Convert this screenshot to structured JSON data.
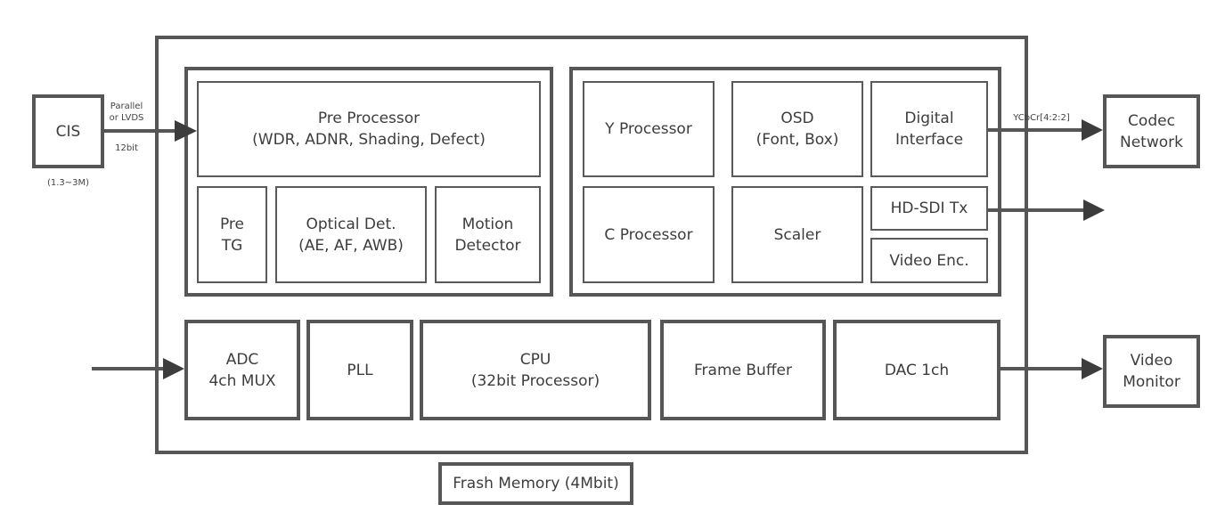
{
  "external": {
    "cis": {
      "label": "CIS",
      "caption": "(1.3~3M)"
    },
    "codec": {
      "label": "Codec\nNetwork"
    },
    "video_monitor": {
      "label": "Video\nMonitor"
    },
    "flash_memory": {
      "label": "Frash Memory (4Mbit)"
    }
  },
  "connections": {
    "cis_to_pre": {
      "label_top": "Parallel\nor LVDS",
      "label_bottom": "12bit"
    },
    "digital_to_codec": {
      "label": "YCbCr[4:2:2]"
    }
  },
  "pre_group": {
    "pre_processor": {
      "label": "Pre Processor\n(WDR, ADNR, Shading, Defect)"
    },
    "pre_tg": {
      "label": "Pre\nTG"
    },
    "optical_det": {
      "label": "Optical Det.\n(AE, AF, AWB)"
    },
    "motion_detector": {
      "label": "Motion\nDetector"
    }
  },
  "post_group": {
    "y_processor": {
      "label": "Y Processor"
    },
    "osd": {
      "label": "OSD\n(Font, Box)"
    },
    "digital_interface": {
      "label": "Digital\nInterface"
    },
    "c_processor": {
      "label": "C Processor"
    },
    "scaler": {
      "label": "Scaler"
    },
    "hd_sdi_tx": {
      "label": "HD-SDI Tx"
    },
    "video_enc": {
      "label": "Video Enc."
    }
  },
  "bottom_row": {
    "adc": {
      "label": "ADC\n4ch MUX"
    },
    "pll": {
      "label": "PLL"
    },
    "cpu": {
      "label": "CPU\n(32bit Processor)"
    },
    "frame_buffer": {
      "label": "Frame Buffer"
    },
    "dac": {
      "label": "DAC 1ch"
    }
  },
  "colors": {
    "line": "#565656",
    "arrow": "#3c3c3c",
    "text": "#3d3d3d"
  }
}
